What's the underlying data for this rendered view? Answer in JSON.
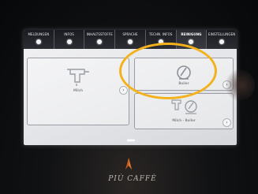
{
  "tabs": [
    {
      "label": "MELDUNGEN",
      "active": false
    },
    {
      "label": "INFOS",
      "active": false
    },
    {
      "label": "INHALTSSTOFFE",
      "active": false
    },
    {
      "label": "SPRACHE",
      "active": false
    },
    {
      "label": "TECHN. INFOS",
      "active": false
    },
    {
      "label": "REINIGUNG",
      "active": true
    },
    {
      "label": "EINSTELLUNGEN",
      "active": false
    }
  ],
  "cards": {
    "left": {
      "label": "Milch",
      "icon": "milk-system-icon"
    },
    "right_top": {
      "label": "Boiler",
      "icon": "boiler-icon"
    },
    "right_bottom": {
      "label": "Milch - Boiler",
      "icon": "milk-boiler-icon"
    }
  },
  "go_symbol": "›",
  "brand": "PIÙ CAFFÈ",
  "colors": {
    "highlight": "#f3b21c",
    "tabbar": "#1a1b20"
  }
}
